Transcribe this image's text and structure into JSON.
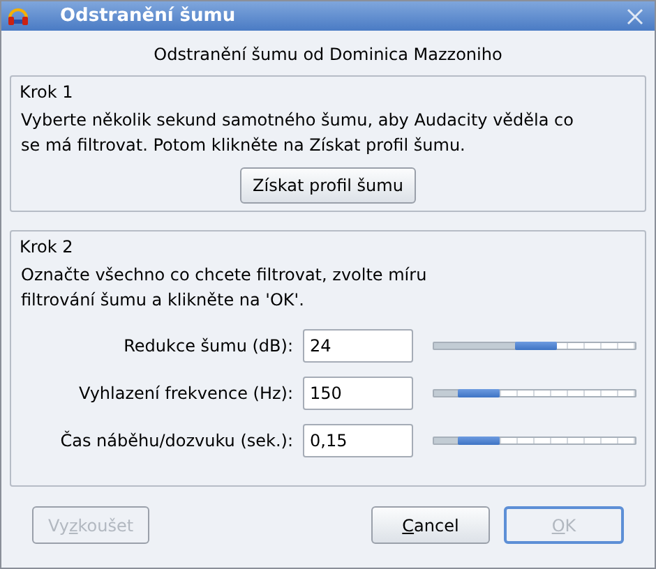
{
  "window": {
    "title": "Odstranění šumu"
  },
  "header": "Odstranění šumu od Dominica Mazzoniho",
  "step1": {
    "title": "Krok 1",
    "text": "Vyberte několik sekund samotného šumu, aby Audacity věděla co se má filtrovat. Potom klikněte na Získat profil šumu.",
    "button": {
      "label": "Získat profil šumu"
    }
  },
  "step2": {
    "title": "Krok 2",
    "text": "Označte všechno co chcete filtrovat, zvolte míru filtrování šumu a klikněte na 'OK'.",
    "params": [
      {
        "label": "Redukce šumu (dB):",
        "value": "24",
        "level": 0.5
      },
      {
        "label": "Vyhlazení frekvence (Hz):",
        "value": "150",
        "level": 0.22
      },
      {
        "label": "Čas náběhu/dozvuku (sek.):",
        "value": "0,15",
        "level": 0.22
      }
    ]
  },
  "buttons": [
    {
      "label_start": "Vy",
      "mnemonic": "z",
      "label_end": "koušet",
      "disabled": true,
      "default": false
    },
    {
      "mnemonic": "C",
      "label_end": "ancel",
      "disabled": false,
      "default": false
    },
    {
      "mnemonic": "O",
      "label_end": "K",
      "disabled": true,
      "default": true
    }
  ]
}
